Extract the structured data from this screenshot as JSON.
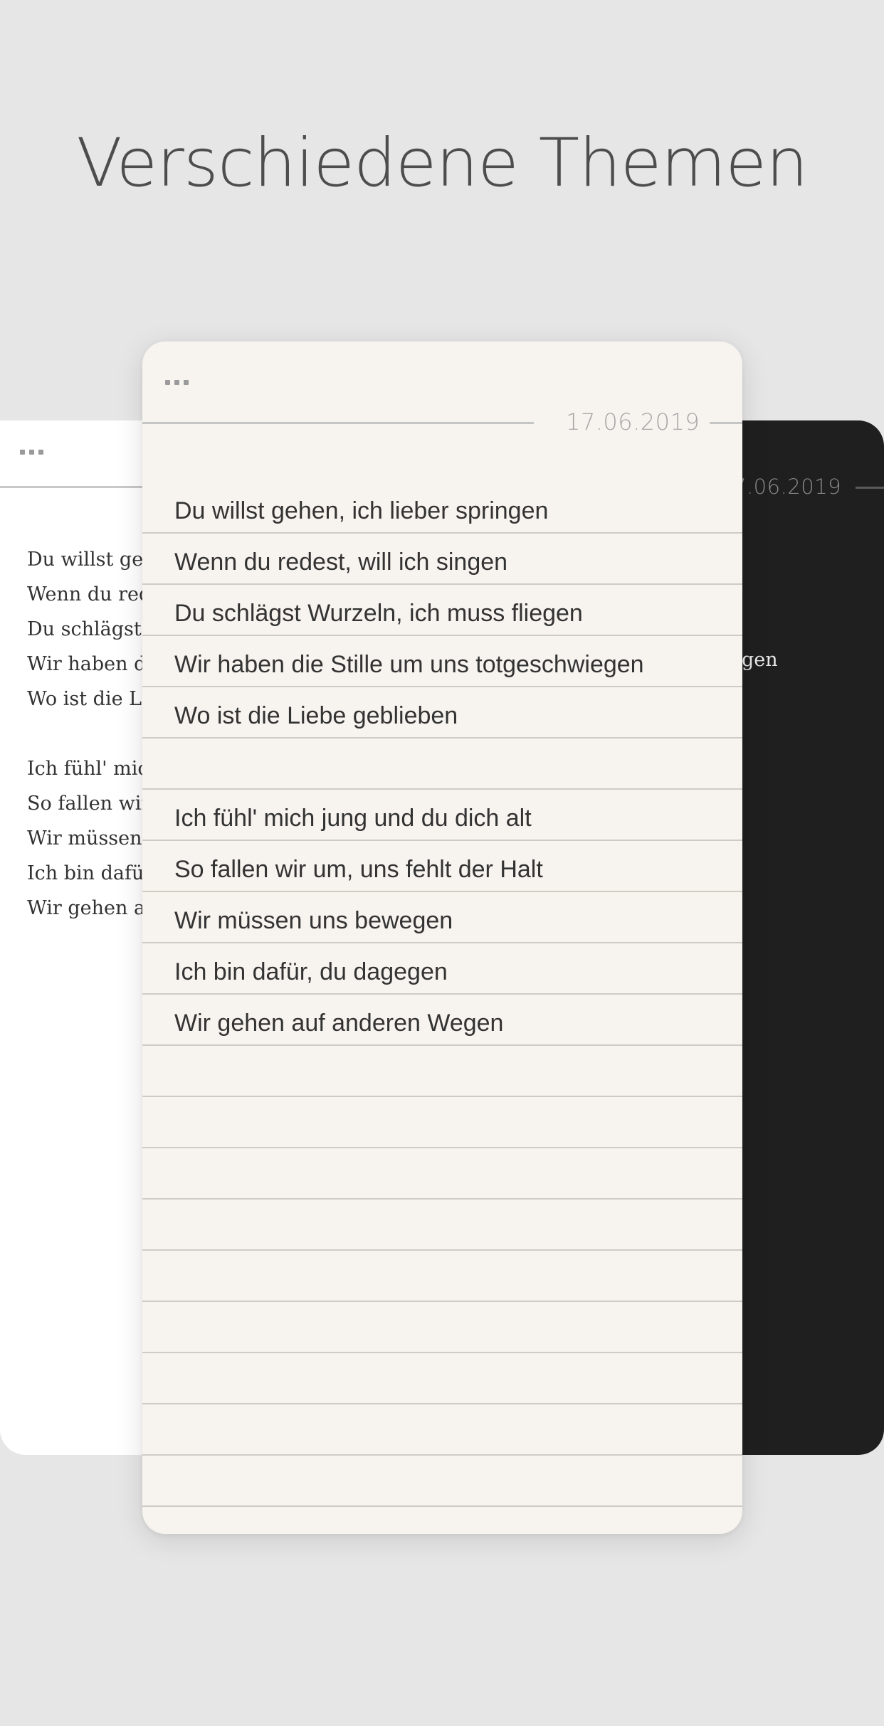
{
  "headline": "Verschiedene Themen",
  "date": "17.06.2019",
  "dark_date_partial": "7.06.2019",
  "dark_visible_text": "gen",
  "poem": {
    "stanza1": [
      "Du willst gehen, ich lieber springen",
      "Wenn du redest, will ich singen",
      "Du schlägst Wurzeln, ich muss fliegen",
      "Wir haben die Stille um uns totgeschwiegen",
      "Wo ist die Liebe geblieben"
    ],
    "stanza2": [
      "Ich fühl' mich jung und du dich alt",
      "So fallen wir um, uns fehlt der Halt",
      "Wir müssen uns bewegen",
      "Ich bin dafür, du dagegen",
      "Wir gehen auf anderen Wegen"
    ]
  },
  "left_partial": {
    "stanza1": [
      "Du willst geh",
      "Wenn du rede",
      "Du schlägst V",
      "Wir haben di",
      "Wo ist die Lie"
    ],
    "stanza2": [
      "Ich fühl' mich",
      "So fallen wir",
      "Wir müssen u",
      "Ich bin dafür,",
      "Wir gehen au"
    ]
  },
  "colors": {
    "background": "#e6e6e6",
    "paper": "#f7f4ef",
    "dark_card": "#1f1f1f",
    "white_card": "#ffffff"
  },
  "icons": {
    "menu": "ellipsis-icon"
  }
}
